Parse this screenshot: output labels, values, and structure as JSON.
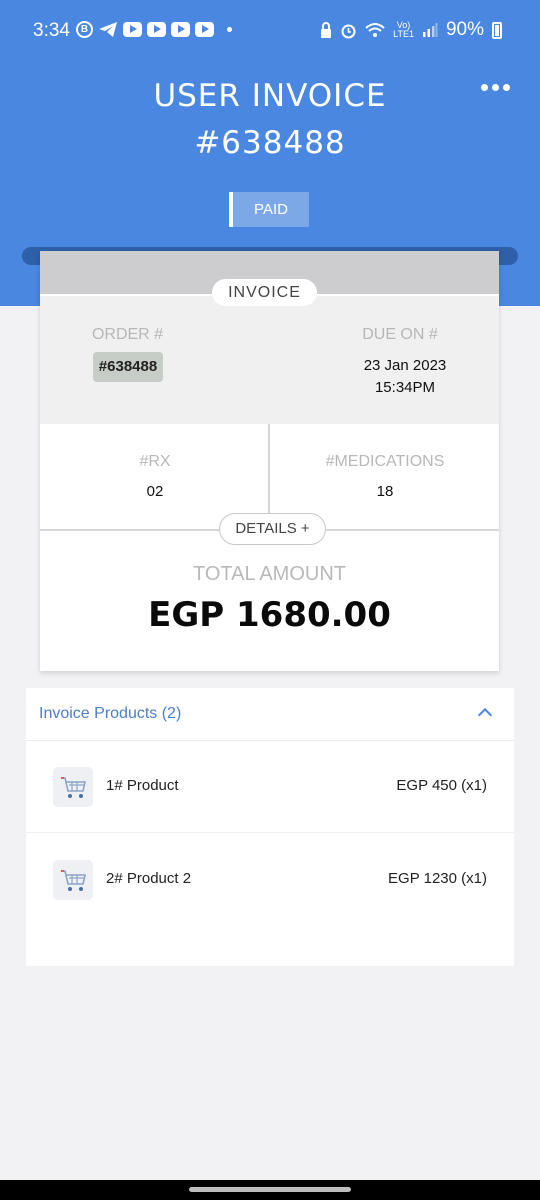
{
  "status_bar": {
    "time": "3:34",
    "b_badge": "B",
    "lte_top": "Vo)",
    "lte_bottom": "LTE1",
    "battery": "90%"
  },
  "header": {
    "title_line1": "USER INVOICE",
    "title_line2": "#638488",
    "status_badge": "PAID",
    "menu_icon": "more-horizontal-icon",
    "accent_color": "#4a87e0"
  },
  "invoice_card": {
    "section_label": "INVOICE",
    "order_label": "ORDER #",
    "order_value": "#638488",
    "due_label": "DUE ON #",
    "due_date": "23 Jan 2023",
    "due_time": "15:34PM",
    "rx_label": "#RX",
    "rx_value": "02",
    "medications_label": "#MEDICATIONS",
    "medications_value": "18",
    "details_button": "DETAILS +",
    "total_label": "TOTAL AMOUNT",
    "total_value": "EGP 1680.00"
  },
  "products": {
    "header": "Invoice Products (2)",
    "items": [
      {
        "name": "1# Product",
        "price": "EGP 450 (x1)",
        "icon": "cart-icon"
      },
      {
        "name": "2# Product 2",
        "price": "EGP 1230 (x1)",
        "icon": "cart-icon"
      }
    ]
  }
}
